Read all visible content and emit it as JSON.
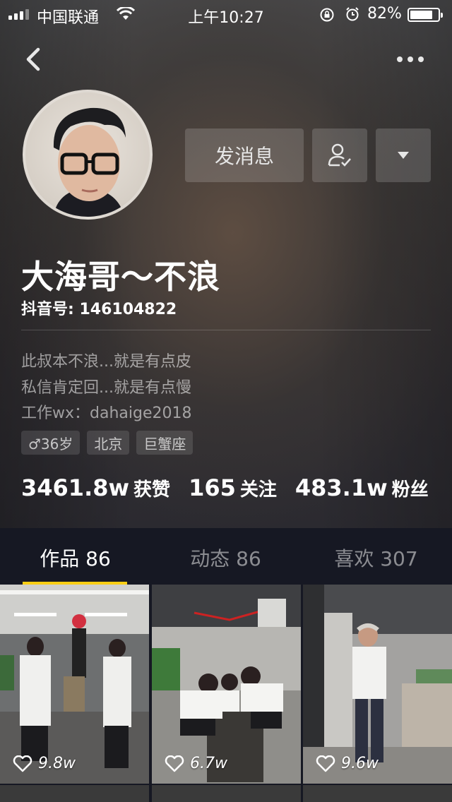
{
  "status_bar": {
    "carrier": "中国联通",
    "time": "上午10:27",
    "battery": "82%",
    "battery_level": 0.82
  },
  "header": {
    "back_icon": "chevron-left-icon",
    "more_icon": "more-horizontal-icon"
  },
  "profile": {
    "nickname": "大海哥～不浪",
    "douyin_id": "抖音号: 146104822",
    "bio": [
      "此叔本不浪...就是有点皮",
      "私信肯定回...就是有点慢",
      "工作wx：dahaige2018"
    ],
    "tags": [
      "♂36岁",
      "北京",
      "巨蟹座"
    ]
  },
  "actions": {
    "message_label": "发消息",
    "follow_icon": "user-check-icon",
    "dropdown_icon": "caret-down-icon"
  },
  "stats": [
    {
      "num": "3461.8w",
      "label": "获赞"
    },
    {
      "num": "165",
      "label": "关注"
    },
    {
      "num": "483.1w",
      "label": "粉丝"
    }
  ],
  "tabs": [
    {
      "label": "作品 86",
      "active": true
    },
    {
      "label": "动态 86",
      "active": false
    },
    {
      "label": "喜欢 307",
      "active": false
    }
  ],
  "videos": [
    {
      "likes": "9.8w"
    },
    {
      "likes": "6.7w"
    },
    {
      "likes": "9.6w"
    }
  ],
  "colors": {
    "accent": "#face15",
    "background": "#161823"
  }
}
